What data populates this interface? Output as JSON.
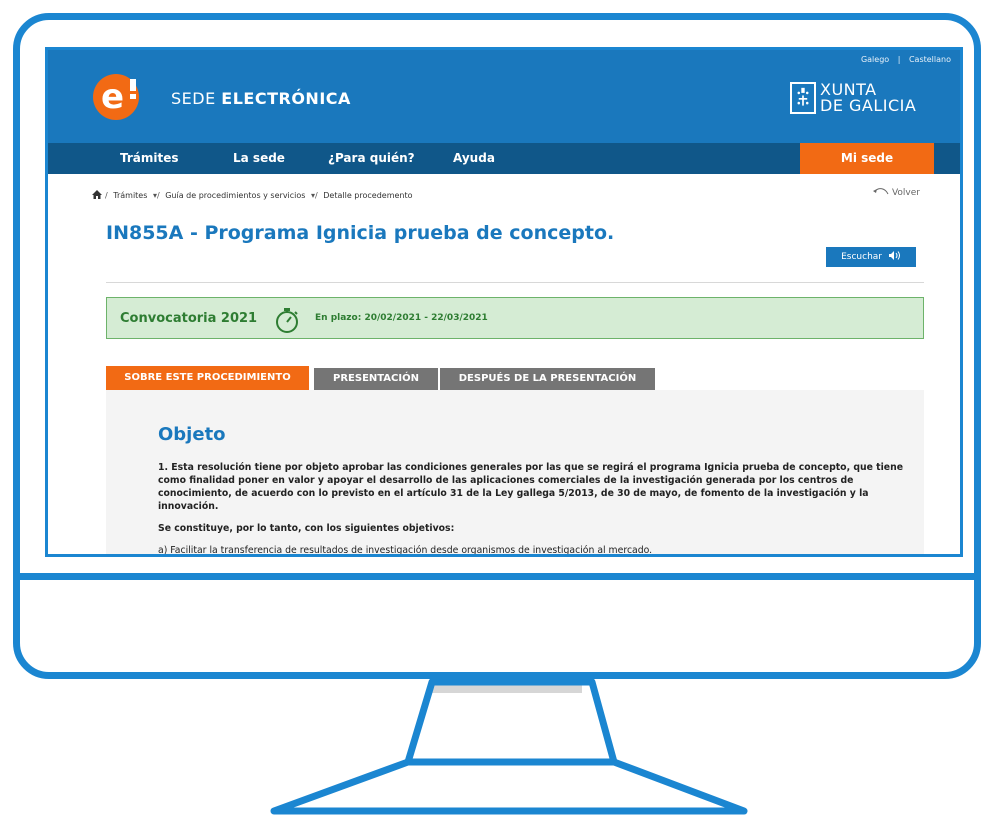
{
  "header": {
    "brand_prefix": "SEDE",
    "brand_main": "ELECTRÓNICA",
    "logo_text": "e",
    "languages": [
      "Galego",
      "Castellano"
    ],
    "lang_separator": "|",
    "xunta_line1": "XUNTA",
    "xunta_line2": "DE GALICIA"
  },
  "nav": {
    "items": [
      "Trámites",
      "La sede",
      "¿Para quién?",
      "Ayuda"
    ],
    "mi_sede": "Mi sede"
  },
  "breadcrumb": {
    "items": [
      "Trámites",
      "Guía de procedimientos y servicios",
      "Detalle procedemento"
    ],
    "volver": "Volver"
  },
  "page": {
    "title": "IN855A - Programa Ignicia prueba de concepto.",
    "escuchar": "Escuchar"
  },
  "convocatoria": {
    "title": "Convocatoria 2021",
    "plazo": "En plazo: 20/02/2021 - 22/03/2021"
  },
  "tabs": [
    "SOBRE ESTE PROCEDIMIENTO",
    "PRESENTACIÓN",
    "DESPUÉS DE LA PRESENTACIÓN"
  ],
  "content": {
    "heading": "Objeto",
    "paragraph1": "1. Esta resolución tiene por objeto aprobar las condiciones generales por las que se regirá el programa Ignicia prueba de concepto, que tiene como finalidad poner en valor y apoyar el desarrollo de las aplicaciones comerciales de la investigación generada por los centros de conocimiento, de acuerdo con lo previsto en el artículo 31 de la Ley gallega 5/2013, de 30 de mayo, de fomento de la investigación y la innovación.",
    "paragraph2": "Se constituye, por lo tanto, con los siguientes objetivos:",
    "paragraph3": "a) Facilitar la transferencia de resultados de investigación desde organismos de investigación al mercado."
  },
  "colors": {
    "frame_blue": "#1b86d1",
    "header_blue": "#1a78bd",
    "nav_blue": "#105789",
    "orange": "#f26a14",
    "green_bg": "#d5ecd4",
    "green_text": "#2e7d32"
  }
}
